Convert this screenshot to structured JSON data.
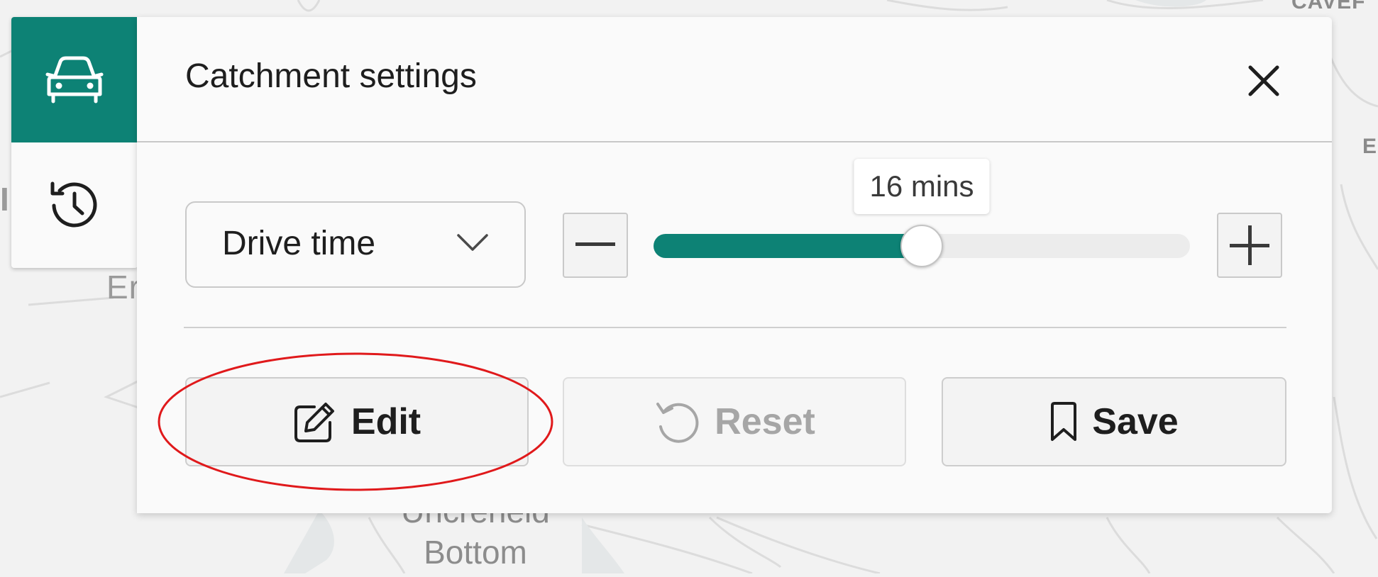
{
  "map": {
    "labels": {
      "top_right": "CAVEF",
      "right_edge": "E",
      "left_edge_top": "I",
      "left_edge": "Er",
      "place_line1": "Uncreneid",
      "place_line2": "Bottom"
    }
  },
  "mode_bar": {
    "items": [
      {
        "name": "drive",
        "icon": "car-icon",
        "active": true
      },
      {
        "name": "history",
        "icon": "history-icon",
        "active": false
      }
    ]
  },
  "panel": {
    "title": "Catchment settings",
    "close_icon": "close-icon",
    "mode_select": {
      "value": "Drive time",
      "icon": "chevron-down-icon"
    },
    "slider": {
      "value": 16,
      "tooltip": "16 mins",
      "fill_fraction": 0.5,
      "minus_icon": "minus-icon",
      "plus_icon": "plus-icon"
    },
    "actions": {
      "edit": {
        "label": "Edit",
        "icon": "edit-icon",
        "enabled": true
      },
      "reset": {
        "label": "Reset",
        "icon": "reset-icon",
        "enabled": false
      },
      "save": {
        "label": "Save",
        "icon": "bookmark-icon",
        "enabled": true
      }
    }
  },
  "colors": {
    "accent": "#0d8275",
    "highlight": "#e0191b"
  }
}
